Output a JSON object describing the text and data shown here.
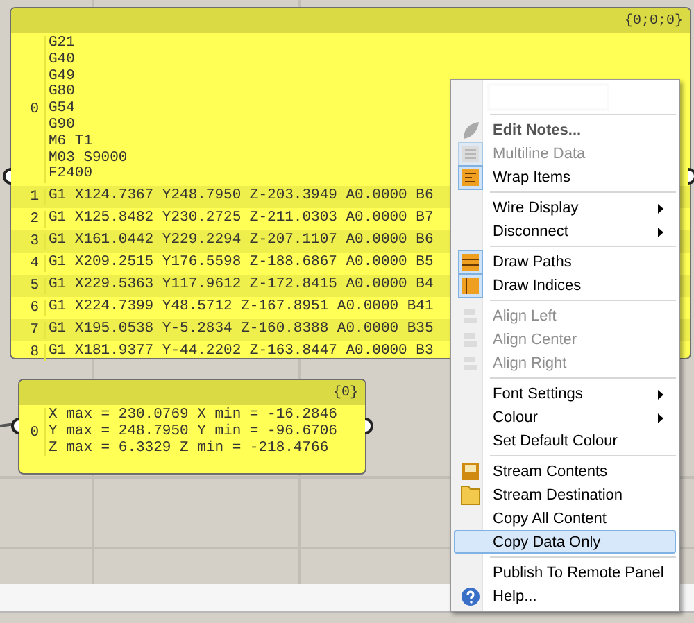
{
  "panels": [
    {
      "path": "{0;0;0}",
      "items": [
        {
          "index": "0",
          "lines": [
            "G21",
            "G40",
            "G49",
            "G80",
            "G54",
            "G90",
            "M6 T1",
            "M03 S9000",
            "F2400"
          ]
        },
        {
          "index": "1",
          "lines": [
            "G1 X124.7367 Y248.7950 Z-203.3949 A0.0000 B6"
          ]
        },
        {
          "index": "2",
          "lines": [
            "G1 X125.8482 Y230.2725 Z-211.0303 A0.0000 B7"
          ]
        },
        {
          "index": "3",
          "lines": [
            "G1 X161.0442 Y229.2294 Z-207.1107 A0.0000 B6"
          ]
        },
        {
          "index": "4",
          "lines": [
            "G1 X209.2515 Y176.5598 Z-188.6867 A0.0000 B5"
          ]
        },
        {
          "index": "5",
          "lines": [
            "G1 X229.5363 Y117.9612 Z-172.8415 A0.0000 B4"
          ]
        },
        {
          "index": "6",
          "lines": [
            "G1 X224.7399 Y48.5712 Z-167.8951 A0.0000 B41"
          ]
        },
        {
          "index": "7",
          "lines": [
            "G1 X195.0538 Y-5.2834 Z-160.8388 A0.0000 B35"
          ]
        },
        {
          "index": "8",
          "lines": [
            "G1 X181.9377 Y-44.2202 Z-163.8447 A0.0000 B3"
          ]
        }
      ]
    },
    {
      "path": "{0}",
      "items": [
        {
          "index": "0",
          "lines": [
            "X max = 230.0769 X min = -16.2846",
            "Y max = 248.7950 Y min = -96.6706",
            "Z max = 6.3329 Z min = -218.4766"
          ]
        }
      ]
    }
  ],
  "context_menu": {
    "items": [
      {
        "kind": "field"
      },
      {
        "kind": "separator"
      },
      {
        "kind": "command",
        "label": "Edit Notes...",
        "default": true,
        "disabled": false,
        "selected": false
      },
      {
        "kind": "toggle",
        "label": "Multiline Data",
        "checked": true,
        "default": false,
        "disabled": true,
        "selected": false
      },
      {
        "kind": "toggle",
        "label": "Wrap Items",
        "checked": true,
        "default": false,
        "disabled": false,
        "selected": false
      },
      {
        "kind": "separator"
      },
      {
        "kind": "submenu",
        "label": "Wire Display",
        "default": false,
        "disabled": false,
        "selected": false
      },
      {
        "kind": "submenu",
        "label": "Disconnect",
        "default": false,
        "disabled": false,
        "selected": false
      },
      {
        "kind": "separator"
      },
      {
        "kind": "toggle",
        "label": "Draw Paths",
        "checked": true,
        "default": false,
        "disabled": false,
        "selected": false
      },
      {
        "kind": "toggle",
        "label": "Draw Indices",
        "checked": true,
        "default": false,
        "disabled": false,
        "selected": false
      },
      {
        "kind": "separator"
      },
      {
        "kind": "command",
        "label": "Align Left",
        "default": false,
        "disabled": true,
        "selected": false
      },
      {
        "kind": "command",
        "label": "Align Center",
        "default": false,
        "disabled": true,
        "selected": false
      },
      {
        "kind": "command",
        "label": "Align Right",
        "default": false,
        "disabled": true,
        "selected": false
      },
      {
        "kind": "separator"
      },
      {
        "kind": "submenu",
        "label": "Font Settings",
        "default": false,
        "disabled": false,
        "selected": false
      },
      {
        "kind": "submenu",
        "label": "Colour",
        "default": false,
        "disabled": false,
        "selected": false
      },
      {
        "kind": "command",
        "label": "Set Default Colour",
        "default": false,
        "disabled": false,
        "selected": false
      },
      {
        "kind": "separator"
      },
      {
        "kind": "command",
        "label": "Stream Contents",
        "default": false,
        "disabled": false,
        "selected": false
      },
      {
        "kind": "command",
        "label": "Stream Destination",
        "default": false,
        "disabled": false,
        "selected": false
      },
      {
        "kind": "command",
        "label": "Copy All Content",
        "default": false,
        "disabled": false,
        "selected": false
      },
      {
        "kind": "command",
        "label": "Copy Data Only",
        "default": false,
        "disabled": false,
        "selected": true
      },
      {
        "kind": "separator"
      },
      {
        "kind": "command",
        "label": "Publish To Remote Panel",
        "default": false,
        "disabled": false,
        "selected": false
      },
      {
        "kind": "command",
        "label": "Help...",
        "default": false,
        "disabled": false,
        "selected": false
      }
    ]
  }
}
